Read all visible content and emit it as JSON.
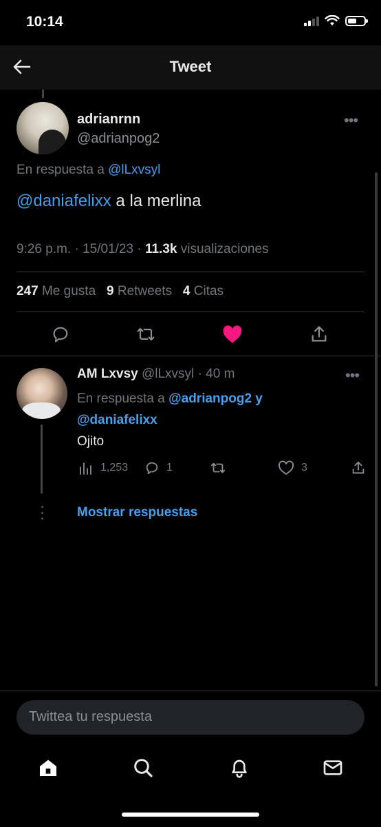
{
  "status_bar": {
    "time": "10:14"
  },
  "header": {
    "title": "Tweet"
  },
  "main_tweet": {
    "author_name": "adrianrnn",
    "author_handle": "@adrianpog2",
    "reply_prefix": "En respuesta a ",
    "reply_to": "@lLxvsyl",
    "mention": "@daniafelixx",
    "text": " a la merlina",
    "time": "9:26 p.m.",
    "sep1": " · ",
    "date": "15/01/23",
    "sep2": " · ",
    "views_count": "11.3k",
    "views_label": " visualizaciones",
    "likes_count": "247",
    "likes_label": " Me gusta",
    "retweets_count": "9",
    "retweets_label": " Retweets",
    "quotes_count": "4",
    "quotes_label": " Citas"
  },
  "reply": {
    "author_name": "AM Lxvsy",
    "author_handle": " @lLxvsyl",
    "sep": " · ",
    "age": "40 m",
    "reply_prefix": "En respuesta a ",
    "reply_to_1": "@adrianpog2",
    "reply_joiner": " y",
    "reply_to_2": "@daniafelixx",
    "text": "Ojito",
    "views": "1,253",
    "replies": "1",
    "likes": "3"
  },
  "show_replies": "Mostrar respuestas",
  "compose": {
    "placeholder": "Twittea tu respuesta"
  },
  "colors": {
    "accent": "#4a9eea",
    "like": "#f91880",
    "background": "#000000"
  },
  "icons": [
    "back-arrow-icon",
    "more-icon",
    "reply-icon",
    "retweet-icon",
    "heart-filled-icon",
    "share-icon",
    "views-icon",
    "heart-icon",
    "home-icon",
    "search-icon",
    "bell-icon",
    "mail-icon"
  ]
}
